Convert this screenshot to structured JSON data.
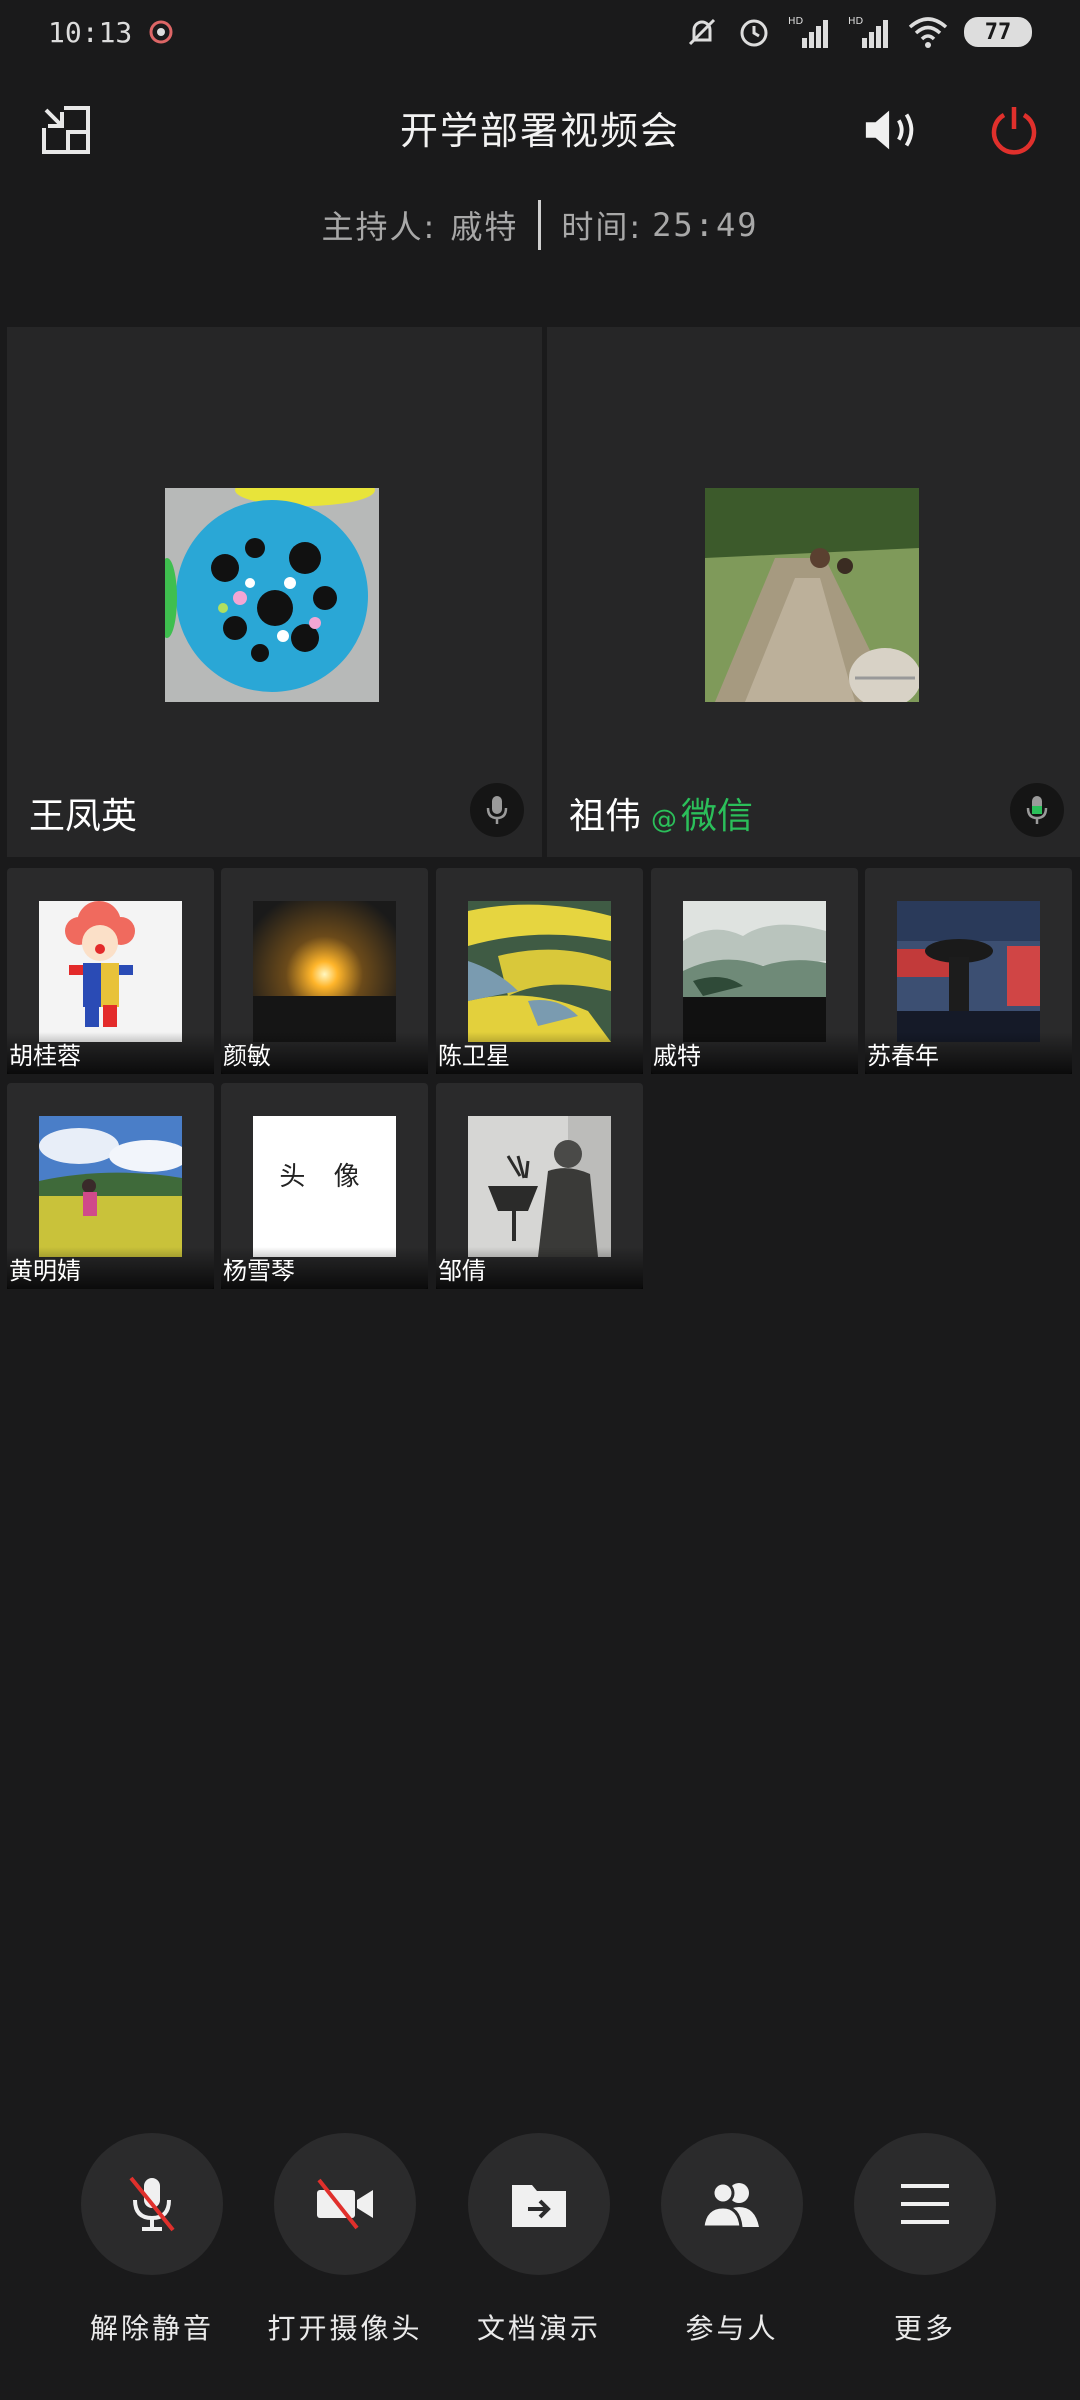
{
  "status_bar": {
    "time": "10:13",
    "battery": "77",
    "signal_1": "HD",
    "signal_2": "HD"
  },
  "header": {
    "title": "开学部署视频会",
    "host_label": "主持人:",
    "host_name": "戚特",
    "time_label": "时间:",
    "elapsed": "25:49"
  },
  "main_tiles": [
    {
      "name": "王凤英",
      "mic": "muted-gray"
    },
    {
      "name": "祖伟",
      "suffix_at": "@",
      "suffix_app": "微信",
      "mic": "active-green"
    }
  ],
  "participants": [
    {
      "name": "胡桂蓉"
    },
    {
      "name": "颜敏"
    },
    {
      "name": "陈卫星"
    },
    {
      "name": "戚特"
    },
    {
      "name": "苏春年"
    },
    {
      "name": "黄明婧"
    },
    {
      "name": "杨雪琴",
      "placeholder": "头 像"
    },
    {
      "name": "邹倩"
    }
  ],
  "controls": [
    {
      "label": "解除静音",
      "icon": "mic-muted-icon"
    },
    {
      "label": "打开摄像头",
      "icon": "camera-off-icon"
    },
    {
      "label": "文档演示",
      "icon": "folder-share-icon"
    },
    {
      "label": "参与人",
      "icon": "people-icon"
    },
    {
      "label": "更多",
      "icon": "menu-icon"
    }
  ],
  "colors": {
    "background": "#1a1a1b",
    "power": "#e0302c",
    "wechat_green": "#2bbf5a"
  }
}
